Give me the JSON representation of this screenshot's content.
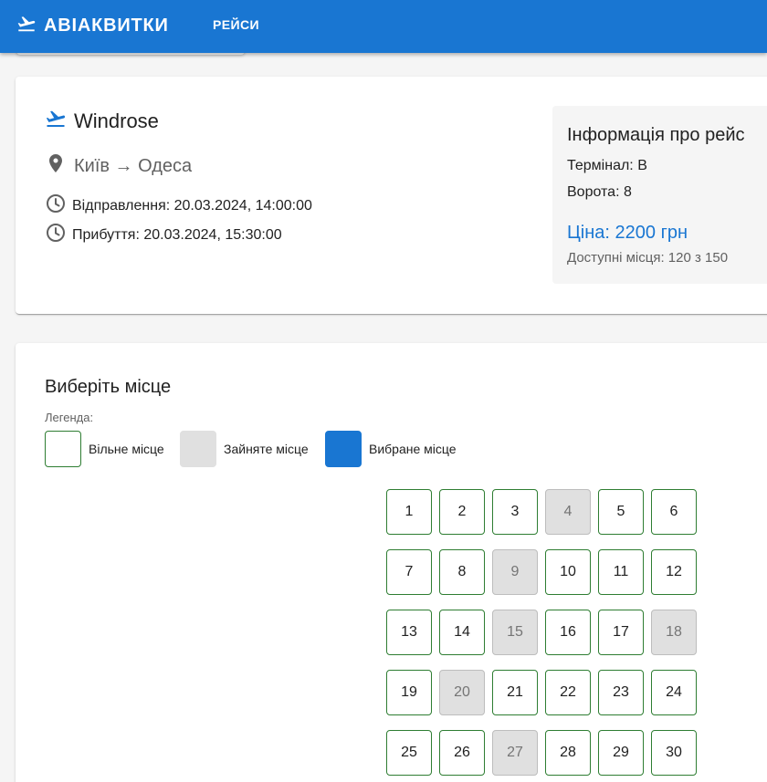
{
  "appbar": {
    "brand": "АВІАКВИТКИ",
    "brand_icon": "plane-takeoff-icon",
    "nav_flights": "РЕЙСИ",
    "color": "#1976d2"
  },
  "flight": {
    "title": "Windrose",
    "route": "Київ → Одеса",
    "departure": "Відправлення: 20.03.2024, 14:00:00",
    "arrival": "Прибуття: 20.03.2024, 15:30:00",
    "info": {
      "title": "Інформація про рейс",
      "terminal": "Термінал: B",
      "gate": "Ворота: 8",
      "price": "Ціна: 2200 грн",
      "available": "Доступні місця: 120 з 150"
    }
  },
  "seats": {
    "title": "Виберіть місце",
    "legend_label": "Легенда:",
    "legend": {
      "free": "Вільне місце",
      "taken": "Зайняте місце",
      "selected": "Вибране місце"
    },
    "colors": {
      "free_border": "#2e7d32",
      "taken": "#e0e0e0",
      "selected": "#1976d2"
    },
    "items": [
      {
        "n": "1",
        "taken": false
      },
      {
        "n": "2",
        "taken": false
      },
      {
        "n": "3",
        "taken": false
      },
      {
        "n": "4",
        "taken": true
      },
      {
        "n": "5",
        "taken": false
      },
      {
        "n": "6",
        "taken": false
      },
      {
        "n": "7",
        "taken": false
      },
      {
        "n": "8",
        "taken": false
      },
      {
        "n": "9",
        "taken": true
      },
      {
        "n": "10",
        "taken": false
      },
      {
        "n": "11",
        "taken": false
      },
      {
        "n": "12",
        "taken": false
      },
      {
        "n": "13",
        "taken": false
      },
      {
        "n": "14",
        "taken": false
      },
      {
        "n": "15",
        "taken": true
      },
      {
        "n": "16",
        "taken": false
      },
      {
        "n": "17",
        "taken": false
      },
      {
        "n": "18",
        "taken": true
      },
      {
        "n": "19",
        "taken": false
      },
      {
        "n": "20",
        "taken": true
      },
      {
        "n": "21",
        "taken": false
      },
      {
        "n": "22",
        "taken": false
      },
      {
        "n": "23",
        "taken": false
      },
      {
        "n": "24",
        "taken": false
      },
      {
        "n": "25",
        "taken": false
      },
      {
        "n": "26",
        "taken": false
      },
      {
        "n": "27",
        "taken": true
      },
      {
        "n": "28",
        "taken": false
      },
      {
        "n": "29",
        "taken": false
      },
      {
        "n": "30",
        "taken": false
      }
    ]
  }
}
